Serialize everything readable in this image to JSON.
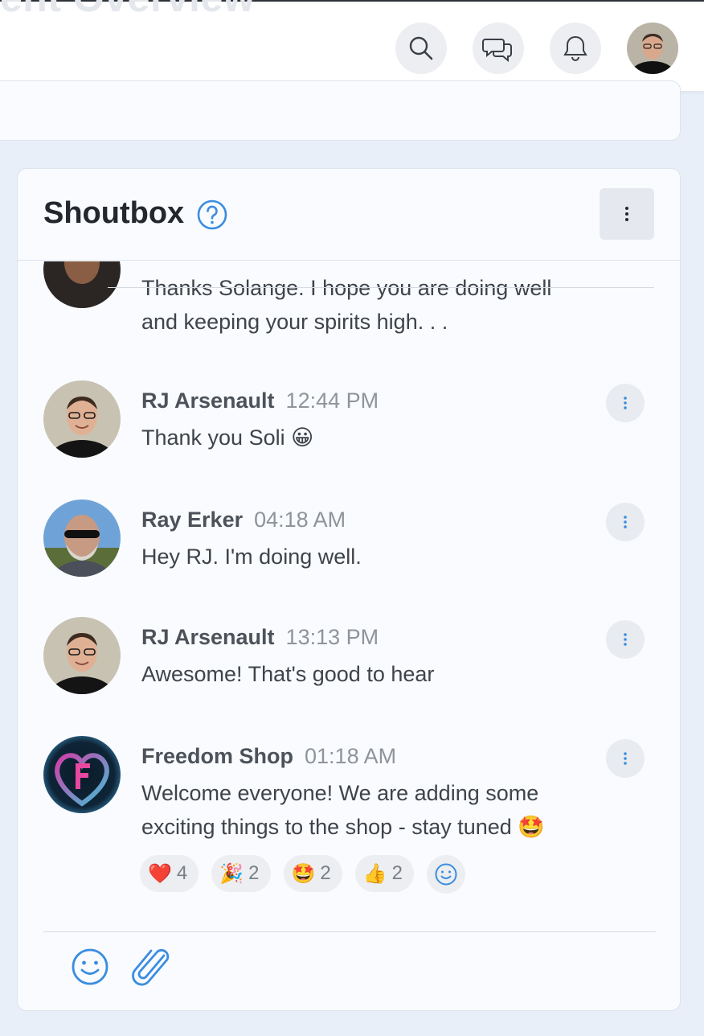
{
  "header": {
    "ghost_title": "ent Overview",
    "icons": [
      "search-icon",
      "chat-icon",
      "bell-icon",
      "user-avatar"
    ]
  },
  "shoutbox": {
    "title": "Shoutbox",
    "help_icon": "question-circle-icon",
    "menu_icon": "vertical-dots-icon",
    "partial_message": {
      "line1": "Thanks Solange. I hope you are doing well",
      "line2": "and keeping your spirits high. . ."
    },
    "messages": [
      {
        "name": "RJ Arsenault",
        "time": "12:44 PM",
        "text": "Thank you Soli 😀"
      },
      {
        "name": "Ray Erker",
        "time": "04:18 AM",
        "text": "Hey RJ. I'm doing well."
      },
      {
        "name": "RJ Arsenault",
        "time": "13:13 PM",
        "text": "Awesome! That's good to hear"
      },
      {
        "name": "Freedom Shop",
        "time": "01:18 AM",
        "line1": "Welcome everyone! We are adding some",
        "line2": "exciting things to the shop - stay tuned 🤩"
      }
    ],
    "reactions": [
      {
        "emoji": "❤️",
        "count": "4"
      },
      {
        "emoji": "🎉",
        "count": "2"
      },
      {
        "emoji": "🤩",
        "count": "2"
      },
      {
        "emoji": "👍",
        "count": "2"
      }
    ],
    "compose_icons": [
      "smiley-icon",
      "paperclip-icon"
    ]
  },
  "colors": {
    "accent": "#3b8de0",
    "page_bg": "#e9eff8",
    "card_bg": "#f9fbfe"
  }
}
